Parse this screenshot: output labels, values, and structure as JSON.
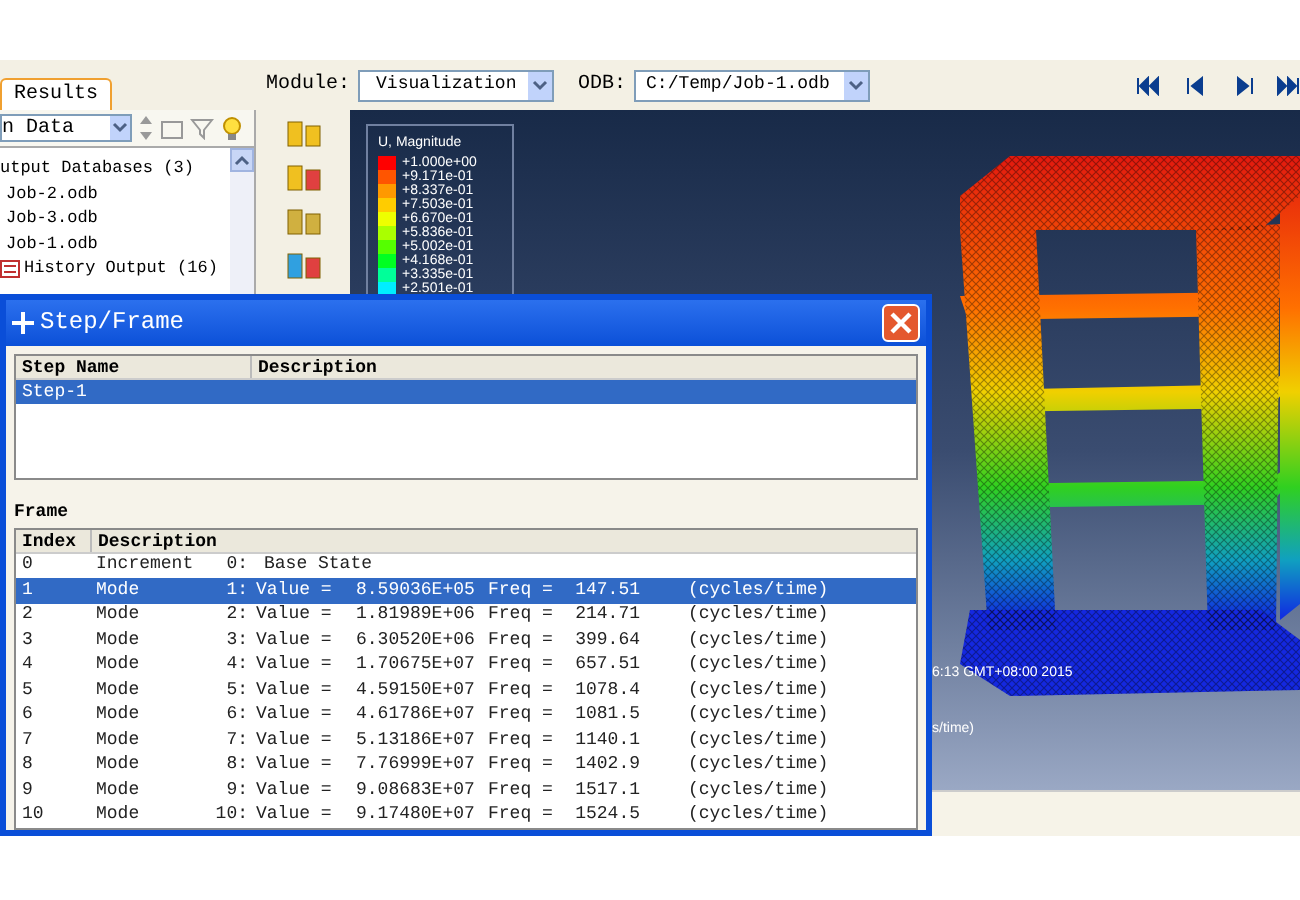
{
  "tabs": [
    {
      "label": "Results",
      "selected": true
    }
  ],
  "model_tree": {
    "filter": "n Data",
    "items": [
      {
        "label": "utput Databases (3)",
        "children": [
          {
            "label": "Job-2.odb"
          },
          {
            "label": "Job-3.odb"
          },
          {
            "label": "Job-1.odb",
            "children": [
              {
                "label": "History Output (16)"
              }
            ]
          }
        ]
      }
    ]
  },
  "context_bar": {
    "module_label": "Module:",
    "module": "Visualization",
    "odb_label": "ODB:",
    "odb": "C:/Temp/Job-1.odb"
  },
  "viewport": {
    "legend": {
      "title": "U, Magnitude",
      "entries": [
        {
          "label": "+1.000e+00",
          "color": "#ff0000"
        },
        {
          "label": "+9.171e-01",
          "color": "#ff5500"
        },
        {
          "label": "+8.337e-01",
          "color": "#ff9900"
        },
        {
          "label": "+7.503e-01",
          "color": "#ffcc00"
        },
        {
          "label": "+6.670e-01",
          "color": "#eeff00"
        },
        {
          "label": "+5.836e-01",
          "color": "#aaff00"
        },
        {
          "label": "+5.002e-01",
          "color": "#55ff00"
        },
        {
          "label": "+4.168e-01",
          "color": "#00ff22"
        },
        {
          "label": "+3.335e-01",
          "color": "#00ff99"
        },
        {
          "label": "+2.501e-01",
          "color": "#00eeff"
        }
      ]
    },
    "overlay_texts": [
      "6:13 GMT+08:00 2015",
      "s/time)"
    ]
  },
  "dialog": {
    "title": "Step/Frame",
    "step_table": {
      "columns": [
        "Step Name",
        "Description"
      ],
      "rows": [
        {
          "step_name": "Step-1",
          "selected": true
        }
      ]
    },
    "frame_label": "Frame",
    "frame_table": {
      "columns": [
        "Index",
        "Description"
      ],
      "rows": [
        {
          "kind": "increment",
          "index": "0",
          "type": "Increment",
          "step": "0:",
          "description": "Base State",
          "selected": false
        },
        {
          "kind": "mode",
          "index": "1",
          "type": "Mode",
          "step": "1:",
          "value_label": "Value =",
          "value": "8.59036E+05",
          "freq_label": "Freq =",
          "freq": "147.51",
          "units": "(cycles/time)",
          "selected": true
        },
        {
          "kind": "mode",
          "index": "2",
          "type": "Mode",
          "step": "2:",
          "value_label": "Value =",
          "value": "1.81989E+06",
          "freq_label": "Freq =",
          "freq": "214.71",
          "units": "(cycles/time)",
          "selected": false
        },
        {
          "kind": "mode",
          "index": "3",
          "type": "Mode",
          "step": "3:",
          "value_label": "Value =",
          "value": "6.30520E+06",
          "freq_label": "Freq =",
          "freq": "399.64",
          "units": "(cycles/time)",
          "selected": false
        },
        {
          "kind": "mode",
          "index": "4",
          "type": "Mode",
          "step": "4:",
          "value_label": "Value =",
          "value": "1.70675E+07",
          "freq_label": "Freq =",
          "freq": "657.51",
          "units": "(cycles/time)",
          "selected": false
        },
        {
          "kind": "mode",
          "index": "5",
          "type": "Mode",
          "step": "5:",
          "value_label": "Value =",
          "value": "4.59150E+07",
          "freq_label": "Freq =",
          "freq": "1078.4",
          "units": "(cycles/time)",
          "selected": false
        },
        {
          "kind": "mode",
          "index": "6",
          "type": "Mode",
          "step": "6:",
          "value_label": "Value =",
          "value": "4.61786E+07",
          "freq_label": "Freq =",
          "freq": "1081.5",
          "units": "(cycles/time)",
          "selected": false
        },
        {
          "kind": "mode",
          "index": "7",
          "type": "Mode",
          "step": "7:",
          "value_label": "Value =",
          "value": "5.13186E+07",
          "freq_label": "Freq =",
          "freq": "1140.1",
          "units": "(cycles/time)",
          "selected": false
        },
        {
          "kind": "mode",
          "index": "8",
          "type": "Mode",
          "step": "8:",
          "value_label": "Value =",
          "value": "7.76999E+07",
          "freq_label": "Freq =",
          "freq": "1402.9",
          "units": "(cycles/time)",
          "selected": false
        },
        {
          "kind": "mode",
          "index": "9",
          "type": "Mode",
          "step": "9:",
          "value_label": "Value =",
          "value": "9.08683E+07",
          "freq_label": "Freq =",
          "freq": "1517.1",
          "units": "(cycles/time)",
          "selected": false
        },
        {
          "kind": "mode",
          "index": "10",
          "type": "Mode",
          "step": "10:",
          "value_label": "Value =",
          "value": "9.17480E+07",
          "freq_label": "Freq =",
          "freq": "1524.5",
          "units": "(cycles/time)",
          "selected": false
        }
      ]
    }
  }
}
